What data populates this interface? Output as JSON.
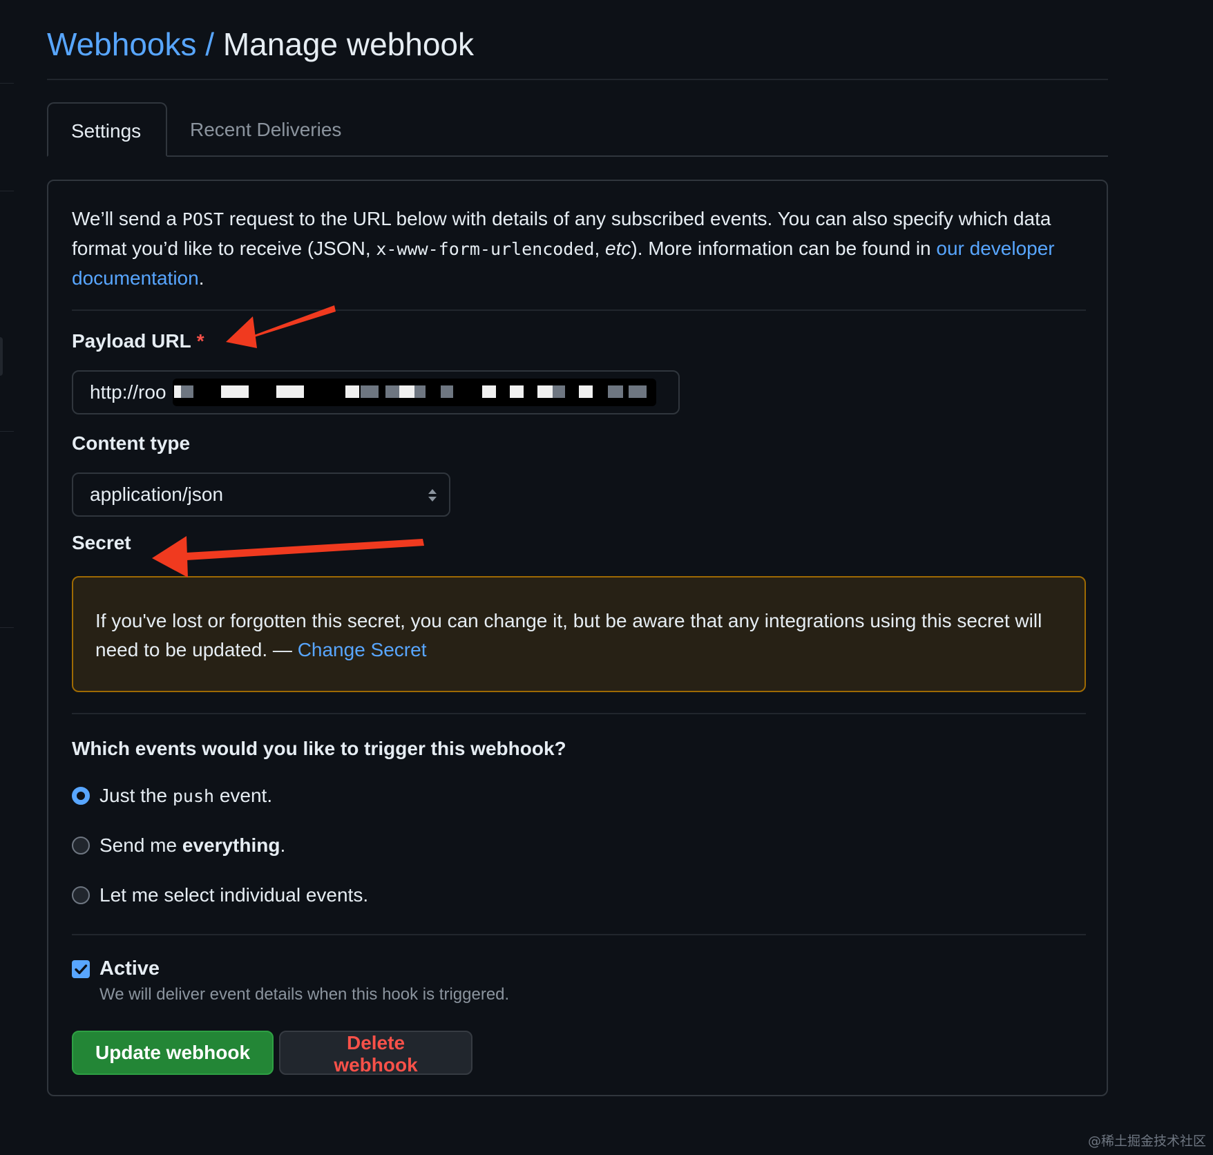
{
  "header": {
    "breadcrumb_link": "Webhooks",
    "separator": "/",
    "title": "Manage webhook"
  },
  "tabs": [
    {
      "label": "Settings",
      "active": true
    },
    {
      "label": "Recent Deliveries",
      "active": false
    }
  ],
  "intro": {
    "part1": "We’ll send a ",
    "method": "POST",
    "part2": " request to the URL below with details of any subscribed events. You can also specify which data format you’d like to receive (JSON, ",
    "format": "x-www-form-urlencoded",
    "part3": ", ",
    "etc": "etc",
    "part4": "). More information can be found in ",
    "link": "our developer documentation",
    "part5": "."
  },
  "payload": {
    "label": "Payload URL",
    "required_mark": "*",
    "value": "http://roo"
  },
  "content_type": {
    "label": "Content type",
    "selected": "application/json"
  },
  "secret": {
    "label": "Secret",
    "notice": "If you've lost or forgotten this secret, you can change it, but be aware that any integrations using this secret will need to be updated. — ",
    "link": "Change Secret"
  },
  "events": {
    "question": "Which events would you like to trigger this webhook?",
    "option_push_pre": "Just the ",
    "option_push_code": "push",
    "option_push_post": " event.",
    "option_all_pre": "Send me ",
    "option_all_bold": "everything",
    "option_all_post": ".",
    "option_individual": "Let me select individual events.",
    "selected": "push"
  },
  "active": {
    "label": "Active",
    "checked": true,
    "note": "We will deliver event details when this hook is triggered."
  },
  "buttons": {
    "update": "Update webhook",
    "delete": "Delete webhook"
  },
  "colors": {
    "background": "#0d1117",
    "link": "#58a6ff",
    "primary_button": "#238636",
    "danger_text": "#f85149",
    "annotation_arrow": "#f03a1f"
  },
  "watermark": "@稀土掘金技术社区"
}
